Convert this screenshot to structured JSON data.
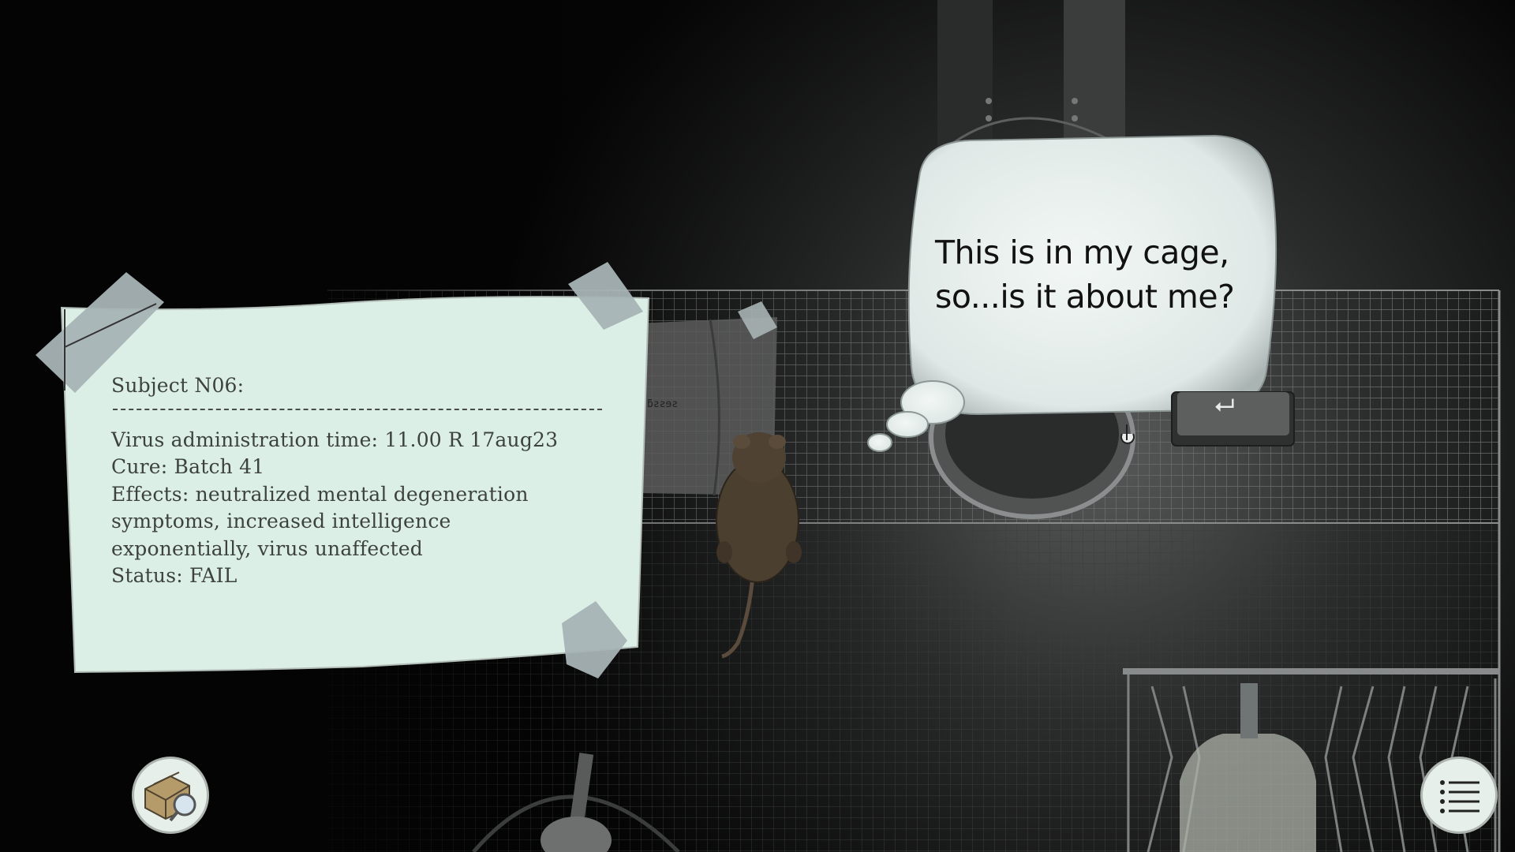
{
  "note": {
    "heading": "Subject N06:",
    "lines": [
      "Virus administration time: 11.00 R 17aug23",
      "Cure: Batch 41",
      "Effects: neutralized mental degeneration",
      "symptoms, increased intelligence",
      "exponentially, virus unaffected",
      "Status: FAIL"
    ]
  },
  "thought_bubble": {
    "line1": "This is in my cage,",
    "line2": "so...is it about me?"
  },
  "controls": {
    "enter_glyph": "⮠",
    "inventory_icon": "box-magnifier-icon",
    "menu_icon": "list-icon"
  },
  "colors": {
    "paper": "#dcefe6",
    "tape": "#a7b3b5",
    "bubble": "#e3ecea",
    "background": "#040404"
  }
}
